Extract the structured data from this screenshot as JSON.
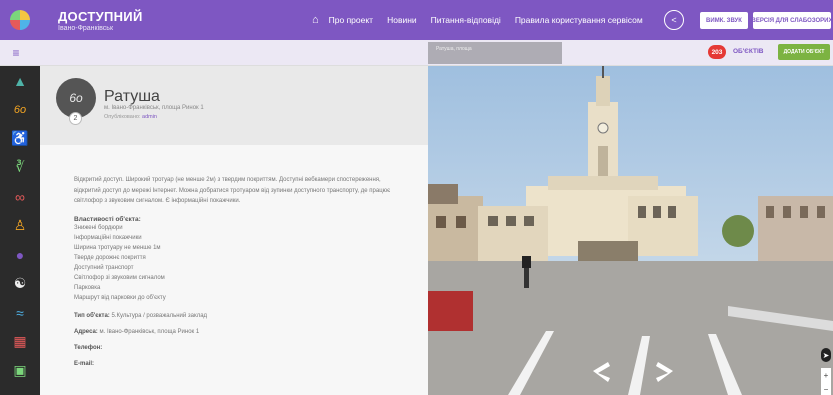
{
  "header": {
    "brand_title": "ДОСТУПНИЙ",
    "brand_sub": "Івано-Франківськ",
    "home_icon": "home-icon",
    "nav": [
      "Про проект",
      "Новини",
      "Питання-відповіді",
      "Правила користування сервісом"
    ],
    "share_icon": "share-icon",
    "sound_btn": "ВИМК. ЗВУК",
    "vision_btn": "ВЕРСІЯ ДЛЯ СЛАБОЗОРИХ"
  },
  "subbar": {
    "filter_icon": "filter-icon",
    "count": "203",
    "count_label": "ОБ'ЄКТІВ",
    "add_button": "ДОДАТИ ОБ'ЄКТ"
  },
  "sidebar": {
    "items": [
      {
        "icon": "map-icon",
        "color": "#4fb3a8"
      },
      {
        "icon": "glasses-icon",
        "color": "#f5a623"
      },
      {
        "icon": "wheelchair-icon",
        "color": "#f5c518"
      },
      {
        "icon": "hearing-icon",
        "color": "#7bd67b"
      },
      {
        "icon": "bicycle-icon",
        "color": "#e55a5a"
      },
      {
        "icon": "family-icon",
        "color": "#f5a623"
      },
      {
        "icon": "head-icon",
        "color": "#7e57c2"
      },
      {
        "icon": "walking-icon",
        "color": "#eeeeee"
      },
      {
        "icon": "wifi-icon",
        "color": "#4fb3e8"
      },
      {
        "icon": "building-icon",
        "color": "#e55a5a"
      },
      {
        "icon": "bus-icon",
        "color": "#7bd67b"
      }
    ]
  },
  "place": {
    "avatar_icon": "glasses-icon",
    "badge": "2",
    "title": "Ратуша",
    "address": "м. Івано-Франківськ, площа Ринок 1",
    "published_prefix": "Опубліковано: ",
    "published_by": "admin",
    "description": "Відкритий доступ. Широкий тротуар (не менше 2м) з твердим покриттям. Доступні вебкамери спостереження, відкритий доступ до мережі Інтернет. Можна добратися тротуаром від зупинки доступного транспорту, де працює світлофор з звуковим сигналом. Є інформаційні покажчики.",
    "properties_title": "Властивості об'єкта:",
    "properties": [
      "Знижені бордюри",
      "Інформаційні покажчики",
      "Ширина тротуару не менше 1м",
      "Тверде дорожнє покриття",
      "Доступний транспорт",
      "Світлофор зі звуковим сигналом",
      "Парковка",
      "Маршрут від парковки до об'єкту"
    ],
    "type_label": "Тип об'єкта:",
    "type_value": "5.Культура / розважальний заклад",
    "address_label": "Адреса:",
    "address_value": "м. Івано-Франківськ, площа Ринок 1",
    "phone_label": "Телефон:",
    "email_label": "E-mail:"
  },
  "streetview": {
    "search_stub": "Ратуша, площа",
    "zoom_in": "+",
    "zoom_out": "−"
  }
}
